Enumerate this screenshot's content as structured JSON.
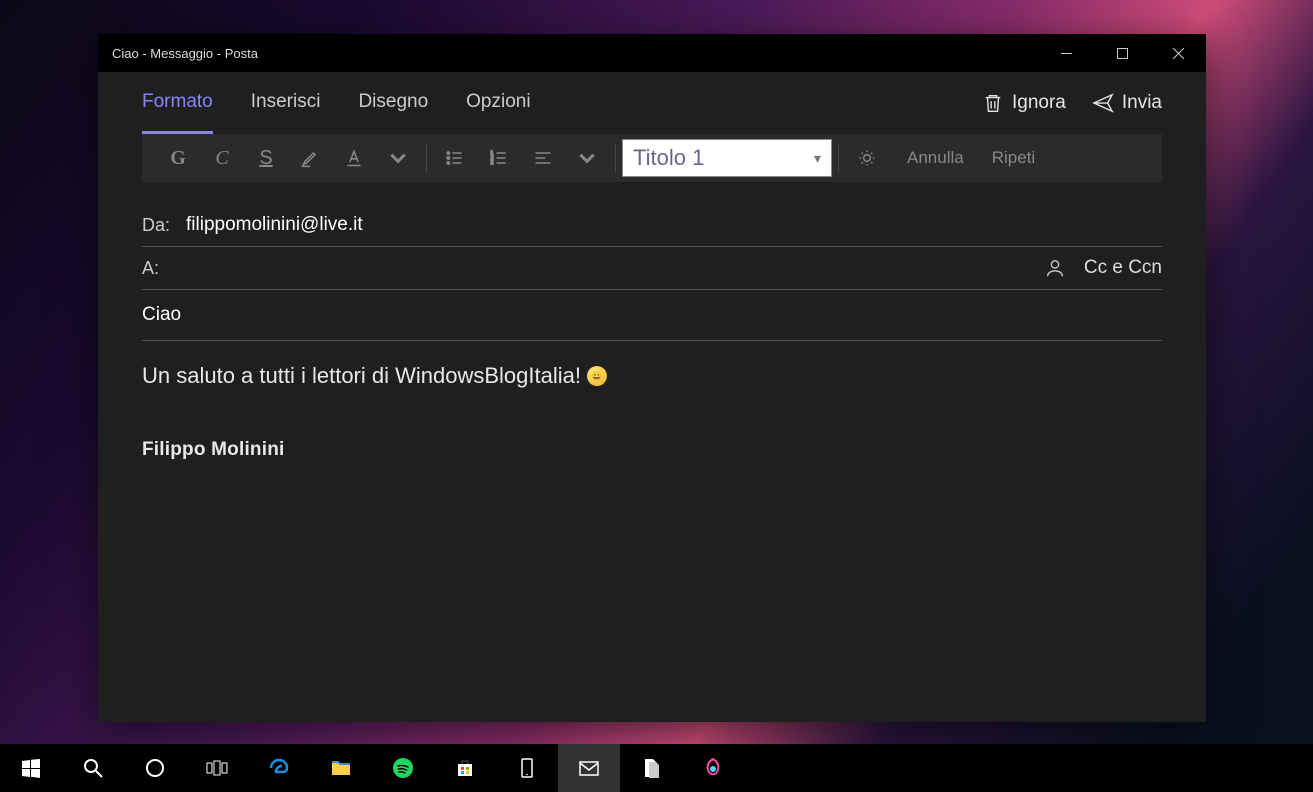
{
  "window": {
    "title": "Ciao - Messaggio - Posta"
  },
  "tabs": {
    "format": "Formato",
    "insert": "Inserisci",
    "draw": "Disegno",
    "options": "Opzioni"
  },
  "actions": {
    "discard": "Ignora",
    "send": "Invia"
  },
  "toolbar": {
    "bold": "G",
    "italic": "C",
    "underline": "S",
    "style_selected": "Titolo 1",
    "undo": "Annulla",
    "redo": "Ripeti"
  },
  "fields": {
    "from_label": "Da:",
    "from_value": "filippomolinini@live.it",
    "to_label": "A:",
    "to_value": "",
    "ccbcc": "Cc e Ccn",
    "subject": "Ciao"
  },
  "body": {
    "text": "Un saluto a tutti i lettori di WindowsBlogItalia!",
    "signature": "Filippo Molinini"
  }
}
